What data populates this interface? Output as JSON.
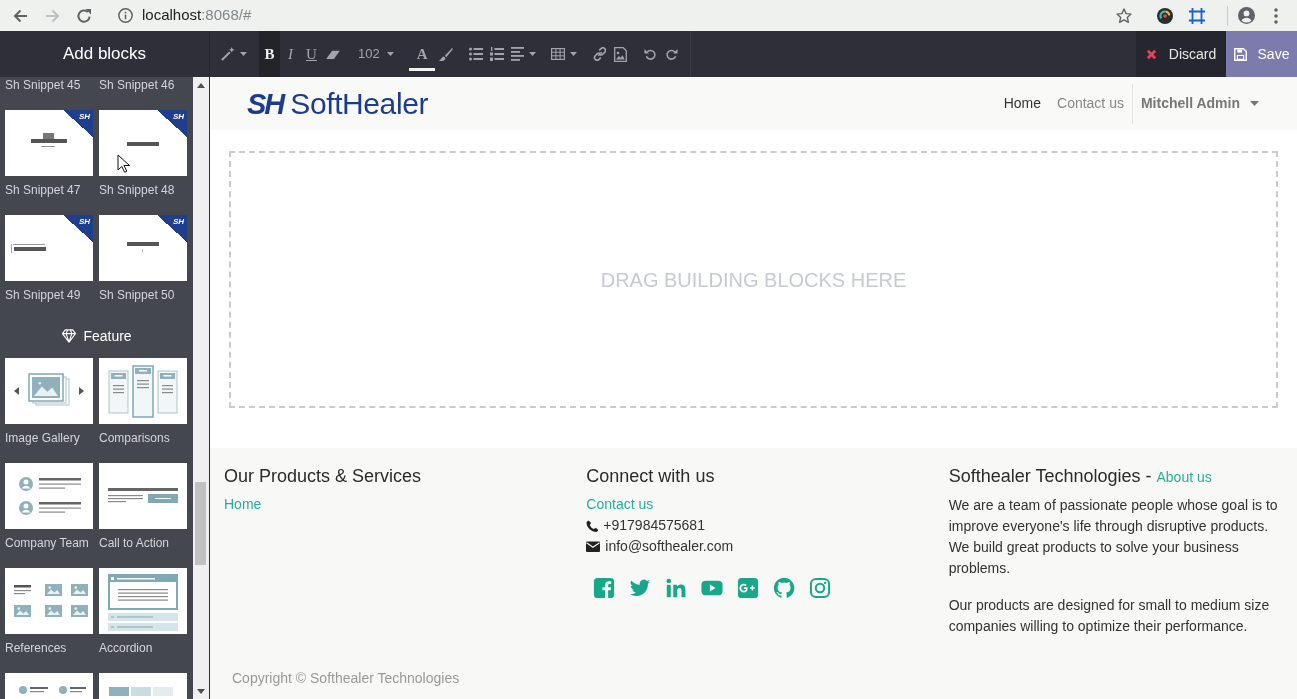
{
  "browser": {
    "nav_buttons": [
      {
        "kind": "back",
        "disabled": false
      },
      {
        "kind": "forward",
        "disabled": true
      },
      {
        "kind": "reload",
        "disabled": false
      }
    ],
    "address": {
      "host": "localhost",
      "rest": ":8068/#"
    },
    "bookmarked": false
  },
  "editor": {
    "panel_title": "Add blocks",
    "tool_groups": [
      [
        {
          "kind": "magic",
          "caret": true
        }
      ],
      [
        {
          "kind": "bold",
          "label": "B",
          "active": true
        },
        {
          "kind": "italic",
          "label": "I",
          "active": false
        },
        {
          "kind": "underline",
          "label": "U",
          "active": false
        },
        {
          "kind": "eraser"
        }
      ],
      [
        {
          "kind": "font-size",
          "label": "102",
          "caret": true
        }
      ],
      [
        {
          "kind": "text-color",
          "label": "A"
        },
        {
          "kind": "brush"
        }
      ],
      [
        {
          "kind": "bullet-list"
        },
        {
          "kind": "number-list"
        },
        {
          "kind": "align",
          "caret": true
        }
      ],
      [
        {
          "kind": "table",
          "caret": true
        }
      ],
      [
        {
          "kind": "link"
        },
        {
          "kind": "image"
        }
      ],
      [
        {
          "kind": "undo"
        },
        {
          "kind": "redo"
        }
      ]
    ],
    "discard": "Discard",
    "save": "Save"
  },
  "sidebar": {
    "groups": [
      {
        "blocks": [
          {
            "kind": "label-only",
            "label": "Sh Snippet 45"
          },
          {
            "kind": "label-only",
            "label": "Sh Snippet 46"
          },
          {
            "kind": "t-bar",
            "label": "Sh Snippet 47",
            "ribbon": "SH"
          },
          {
            "kind": "bar",
            "label": "Sh Snippet 48",
            "ribbon": "SH"
          },
          {
            "kind": "side-bar",
            "label": "Sh Snippet 49",
            "ribbon": "SH"
          },
          {
            "kind": "bar-tick",
            "label": "Sh Snippet 50",
            "ribbon": "SH"
          }
        ]
      },
      {
        "title": "Feature",
        "blocks": [
          {
            "kind": "gallery",
            "label": "Image Gallery"
          },
          {
            "kind": "comparison",
            "label": "Comparisons"
          },
          {
            "kind": "team",
            "label": "Company Team"
          },
          {
            "kind": "cta",
            "label": "Call to Action"
          },
          {
            "kind": "references",
            "label": "References"
          },
          {
            "kind": "accordion",
            "label": "Accordion"
          },
          {
            "kind": "dots-list"
          },
          {
            "kind": "blocks-row"
          }
        ]
      }
    ]
  },
  "site": {
    "logo": {
      "mark": "SH",
      "name": "SoftHealer"
    },
    "menu": [
      {
        "label": "Home",
        "selected": true
      },
      {
        "label": "Contact us",
        "selected": false
      }
    ],
    "user": "Mitchell Admin"
  },
  "drop_zone": "DRAG BUILDING BLOCKS HERE",
  "footer": {
    "columns": [
      {
        "kind": "links",
        "title": "Our Products & Services",
        "links": [
          "Home"
        ]
      },
      {
        "kind": "contact",
        "title": "Connect with us",
        "links": [
          "Contact us"
        ],
        "contacts": [
          {
            "kind": "phone",
            "text": "+917984575681"
          },
          {
            "kind": "email",
            "text": "info@softhealer.com"
          }
        ],
        "social": [
          {
            "kind": "facebook"
          },
          {
            "kind": "twitter"
          },
          {
            "kind": "linkedin"
          },
          {
            "kind": "youtube"
          },
          {
            "kind": "google-plus"
          },
          {
            "kind": "github"
          },
          {
            "kind": "instagram"
          }
        ]
      },
      {
        "kind": "about",
        "title": "Softhealer Technologies",
        "separator": "-",
        "title_link": "About us",
        "paragraphs": [
          "We are a team of passionate people whose goal is to improve everyone's life through disruptive products. We build great products to solve your business problems.",
          "Our products are designed for small to medium size companies willing to optimize their performance."
        ]
      }
    ],
    "copyright": "Copyright © Softhealer Technologies"
  }
}
